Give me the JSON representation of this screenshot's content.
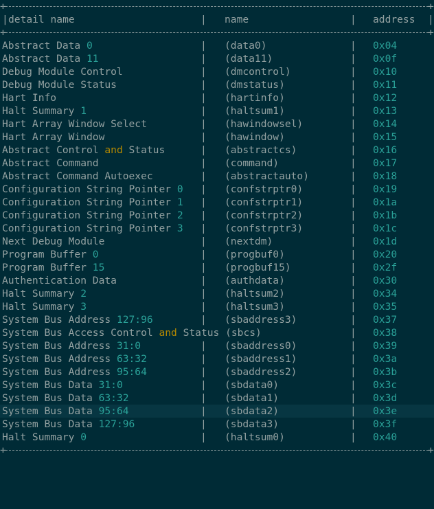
{
  "table": {
    "headers": {
      "detail": "detail name",
      "name": "name",
      "address": "address"
    },
    "border_plus": "+",
    "separator": "|",
    "rows": [
      {
        "detail": [
          {
            "t": "Abstract Data "
          },
          {
            "t": "0",
            "c": "num"
          }
        ],
        "name": "(data0)",
        "address": "0x04"
      },
      {
        "detail": [
          {
            "t": "Abstract Data "
          },
          {
            "t": "11",
            "c": "num"
          }
        ],
        "name": "(data11)",
        "address": "0x0f"
      },
      {
        "detail": [
          {
            "t": "Debug Module Control"
          }
        ],
        "name": "(dmcontrol)",
        "address": "0x10"
      },
      {
        "detail": [
          {
            "t": "Debug Module Status"
          }
        ],
        "name": "(dmstatus)",
        "address": "0x11"
      },
      {
        "detail": [
          {
            "t": "Hart Info"
          }
        ],
        "name": "(hartinfo)",
        "address": "0x12"
      },
      {
        "detail": [
          {
            "t": "Halt Summary "
          },
          {
            "t": "1",
            "c": "num"
          }
        ],
        "name": "(haltsum1)",
        "address": "0x13"
      },
      {
        "detail": [
          {
            "t": "Hart Array Window Select"
          }
        ],
        "name": "(hawindowsel)",
        "address": "0x14"
      },
      {
        "detail": [
          {
            "t": "Hart Array Window"
          }
        ],
        "name": "(hawindow)",
        "address": "0x15"
      },
      {
        "detail": [
          {
            "t": "Abstract Control "
          },
          {
            "t": "and",
            "c": "kw"
          },
          {
            "t": " Status"
          }
        ],
        "name": "(abstractcs)",
        "address": "0x16"
      },
      {
        "detail": [
          {
            "t": "Abstract Command"
          }
        ],
        "name": "(command)",
        "address": "0x17"
      },
      {
        "detail": [
          {
            "t": "Abstract Command Autoexec"
          }
        ],
        "name": "(abstractauto)",
        "address": "0x18"
      },
      {
        "detail": [
          {
            "t": "Configuration String Pointer "
          },
          {
            "t": "0",
            "c": "num"
          }
        ],
        "name": "(confstrptr0)",
        "address": "0x19"
      },
      {
        "detail": [
          {
            "t": "Configuration String Pointer "
          },
          {
            "t": "1",
            "c": "num"
          }
        ],
        "name": "(confstrptr1)",
        "address": "0x1a"
      },
      {
        "detail": [
          {
            "t": "Configuration String Pointer "
          },
          {
            "t": "2",
            "c": "num"
          }
        ],
        "name": "(confstrptr2)",
        "address": "0x1b"
      },
      {
        "detail": [
          {
            "t": "Configuration String Pointer "
          },
          {
            "t": "3",
            "c": "num"
          }
        ],
        "name": "(confstrptr3)",
        "address": "0x1c"
      },
      {
        "detail": [
          {
            "t": "Next Debug Module"
          }
        ],
        "name": "(nextdm)",
        "address": "0x1d"
      },
      {
        "detail": [
          {
            "t": "Program Buffer "
          },
          {
            "t": "0",
            "c": "num"
          }
        ],
        "name": "(progbuf0)",
        "address": "0x20"
      },
      {
        "detail": [
          {
            "t": "Program Buffer "
          },
          {
            "t": "15",
            "c": "num"
          }
        ],
        "name": "(progbuf15)",
        "address": "0x2f"
      },
      {
        "detail": [
          {
            "t": "Authentication Data"
          }
        ],
        "name": "(authdata)",
        "address": "0x30"
      },
      {
        "detail": [
          {
            "t": "Halt Summary "
          },
          {
            "t": "2",
            "c": "num"
          }
        ],
        "name": "(haltsum2)",
        "address": "0x34"
      },
      {
        "detail": [
          {
            "t": "Halt Summary "
          },
          {
            "t": "3",
            "c": "num"
          }
        ],
        "name": "(haltsum3)",
        "address": "0x35"
      },
      {
        "detail": [
          {
            "t": "System Bus Address "
          },
          {
            "t": "127:96",
            "c": "num"
          }
        ],
        "name": "(sbaddress3)",
        "address": "0x37"
      },
      {
        "detail": [
          {
            "t": "System Bus Access Control "
          },
          {
            "t": "and",
            "c": "kw"
          },
          {
            "t": " Status (sbcs)"
          }
        ],
        "name": "",
        "address": "0x38",
        "wide": true
      },
      {
        "detail": [
          {
            "t": "System Bus Address "
          },
          {
            "t": "31:0",
            "c": "num"
          }
        ],
        "name": "(sbaddress0)",
        "address": "0x39"
      },
      {
        "detail": [
          {
            "t": "System Bus Address "
          },
          {
            "t": "63:32",
            "c": "num"
          }
        ],
        "name": "(sbaddress1)",
        "address": "0x3a"
      },
      {
        "detail": [
          {
            "t": "System Bus Address "
          },
          {
            "t": "95:64",
            "c": "num"
          }
        ],
        "name": "(sbaddress2)",
        "address": "0x3b"
      },
      {
        "detail": [
          {
            "t": "System Bus Data "
          },
          {
            "t": "31:0",
            "c": "num"
          }
        ],
        "name": "(sbdata0)",
        "address": "0x3c"
      },
      {
        "detail": [
          {
            "t": "System Bus Data "
          },
          {
            "t": "63:32",
            "c": "num"
          }
        ],
        "name": "(sbdata1)",
        "address": "0x3d"
      },
      {
        "detail": [
          {
            "t": "System Bus Data "
          },
          {
            "t": "95:64",
            "c": "num"
          }
        ],
        "name": "(sbdata2)",
        "address": "0x3e",
        "highlight": true
      },
      {
        "detail": [
          {
            "t": "System Bus Data "
          },
          {
            "t": "127:96",
            "c": "num"
          }
        ],
        "name": "(sbdata3)",
        "address": "0x3f"
      },
      {
        "detail": [
          {
            "t": "Halt Summary "
          },
          {
            "t": "0",
            "c": "num"
          }
        ],
        "name": "(haltsum0)",
        "address": "0x40"
      }
    ]
  },
  "colors": {
    "background": "#002b36",
    "text": "#93a1a1",
    "number": "#2aa198",
    "keyword": "#b58900",
    "highlight": "#073642"
  }
}
